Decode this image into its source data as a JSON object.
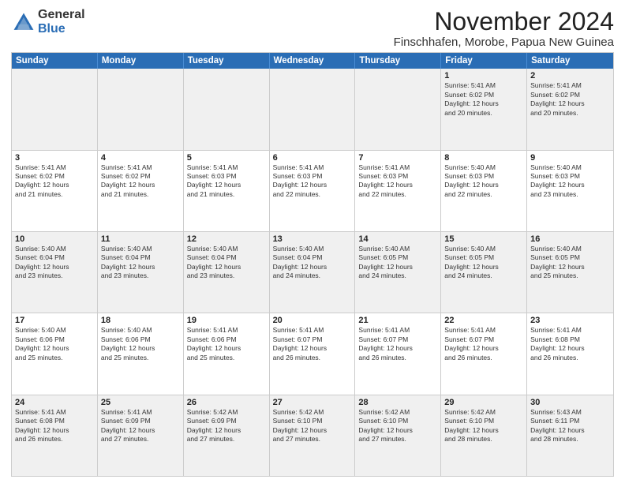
{
  "logo": {
    "general": "General",
    "blue": "Blue"
  },
  "title": {
    "month_year": "November 2024",
    "location": "Finschhafen, Morobe, Papua New Guinea"
  },
  "header": {
    "days": [
      "Sunday",
      "Monday",
      "Tuesday",
      "Wednesday",
      "Thursday",
      "Friday",
      "Saturday"
    ]
  },
  "weeks": [
    {
      "cells": [
        {
          "day": "",
          "info": "",
          "empty": true
        },
        {
          "day": "",
          "info": "",
          "empty": true
        },
        {
          "day": "",
          "info": "",
          "empty": true
        },
        {
          "day": "",
          "info": "",
          "empty": true
        },
        {
          "day": "",
          "info": "",
          "empty": true
        },
        {
          "day": "1",
          "info": "Sunrise: 5:41 AM\nSunset: 6:02 PM\nDaylight: 12 hours\nand 20 minutes."
        },
        {
          "day": "2",
          "info": "Sunrise: 5:41 AM\nSunset: 6:02 PM\nDaylight: 12 hours\nand 20 minutes."
        }
      ]
    },
    {
      "cells": [
        {
          "day": "3",
          "info": "Sunrise: 5:41 AM\nSunset: 6:02 PM\nDaylight: 12 hours\nand 21 minutes."
        },
        {
          "day": "4",
          "info": "Sunrise: 5:41 AM\nSunset: 6:02 PM\nDaylight: 12 hours\nand 21 minutes."
        },
        {
          "day": "5",
          "info": "Sunrise: 5:41 AM\nSunset: 6:03 PM\nDaylight: 12 hours\nand 21 minutes."
        },
        {
          "day": "6",
          "info": "Sunrise: 5:41 AM\nSunset: 6:03 PM\nDaylight: 12 hours\nand 22 minutes."
        },
        {
          "day": "7",
          "info": "Sunrise: 5:41 AM\nSunset: 6:03 PM\nDaylight: 12 hours\nand 22 minutes."
        },
        {
          "day": "8",
          "info": "Sunrise: 5:40 AM\nSunset: 6:03 PM\nDaylight: 12 hours\nand 22 minutes."
        },
        {
          "day": "9",
          "info": "Sunrise: 5:40 AM\nSunset: 6:03 PM\nDaylight: 12 hours\nand 23 minutes."
        }
      ]
    },
    {
      "cells": [
        {
          "day": "10",
          "info": "Sunrise: 5:40 AM\nSunset: 6:04 PM\nDaylight: 12 hours\nand 23 minutes."
        },
        {
          "day": "11",
          "info": "Sunrise: 5:40 AM\nSunset: 6:04 PM\nDaylight: 12 hours\nand 23 minutes."
        },
        {
          "day": "12",
          "info": "Sunrise: 5:40 AM\nSunset: 6:04 PM\nDaylight: 12 hours\nand 23 minutes."
        },
        {
          "day": "13",
          "info": "Sunrise: 5:40 AM\nSunset: 6:04 PM\nDaylight: 12 hours\nand 24 minutes."
        },
        {
          "day": "14",
          "info": "Sunrise: 5:40 AM\nSunset: 6:05 PM\nDaylight: 12 hours\nand 24 minutes."
        },
        {
          "day": "15",
          "info": "Sunrise: 5:40 AM\nSunset: 6:05 PM\nDaylight: 12 hours\nand 24 minutes."
        },
        {
          "day": "16",
          "info": "Sunrise: 5:40 AM\nSunset: 6:05 PM\nDaylight: 12 hours\nand 25 minutes."
        }
      ]
    },
    {
      "cells": [
        {
          "day": "17",
          "info": "Sunrise: 5:40 AM\nSunset: 6:06 PM\nDaylight: 12 hours\nand 25 minutes."
        },
        {
          "day": "18",
          "info": "Sunrise: 5:40 AM\nSunset: 6:06 PM\nDaylight: 12 hours\nand 25 minutes."
        },
        {
          "day": "19",
          "info": "Sunrise: 5:41 AM\nSunset: 6:06 PM\nDaylight: 12 hours\nand 25 minutes."
        },
        {
          "day": "20",
          "info": "Sunrise: 5:41 AM\nSunset: 6:07 PM\nDaylight: 12 hours\nand 26 minutes."
        },
        {
          "day": "21",
          "info": "Sunrise: 5:41 AM\nSunset: 6:07 PM\nDaylight: 12 hours\nand 26 minutes."
        },
        {
          "day": "22",
          "info": "Sunrise: 5:41 AM\nSunset: 6:07 PM\nDaylight: 12 hours\nand 26 minutes."
        },
        {
          "day": "23",
          "info": "Sunrise: 5:41 AM\nSunset: 6:08 PM\nDaylight: 12 hours\nand 26 minutes."
        }
      ]
    },
    {
      "cells": [
        {
          "day": "24",
          "info": "Sunrise: 5:41 AM\nSunset: 6:08 PM\nDaylight: 12 hours\nand 26 minutes."
        },
        {
          "day": "25",
          "info": "Sunrise: 5:41 AM\nSunset: 6:09 PM\nDaylight: 12 hours\nand 27 minutes."
        },
        {
          "day": "26",
          "info": "Sunrise: 5:42 AM\nSunset: 6:09 PM\nDaylight: 12 hours\nand 27 minutes."
        },
        {
          "day": "27",
          "info": "Sunrise: 5:42 AM\nSunset: 6:10 PM\nDaylight: 12 hours\nand 27 minutes."
        },
        {
          "day": "28",
          "info": "Sunrise: 5:42 AM\nSunset: 6:10 PM\nDaylight: 12 hours\nand 27 minutes."
        },
        {
          "day": "29",
          "info": "Sunrise: 5:42 AM\nSunset: 6:10 PM\nDaylight: 12 hours\nand 28 minutes."
        },
        {
          "day": "30",
          "info": "Sunrise: 5:43 AM\nSunset: 6:11 PM\nDaylight: 12 hours\nand 28 minutes."
        }
      ]
    }
  ]
}
